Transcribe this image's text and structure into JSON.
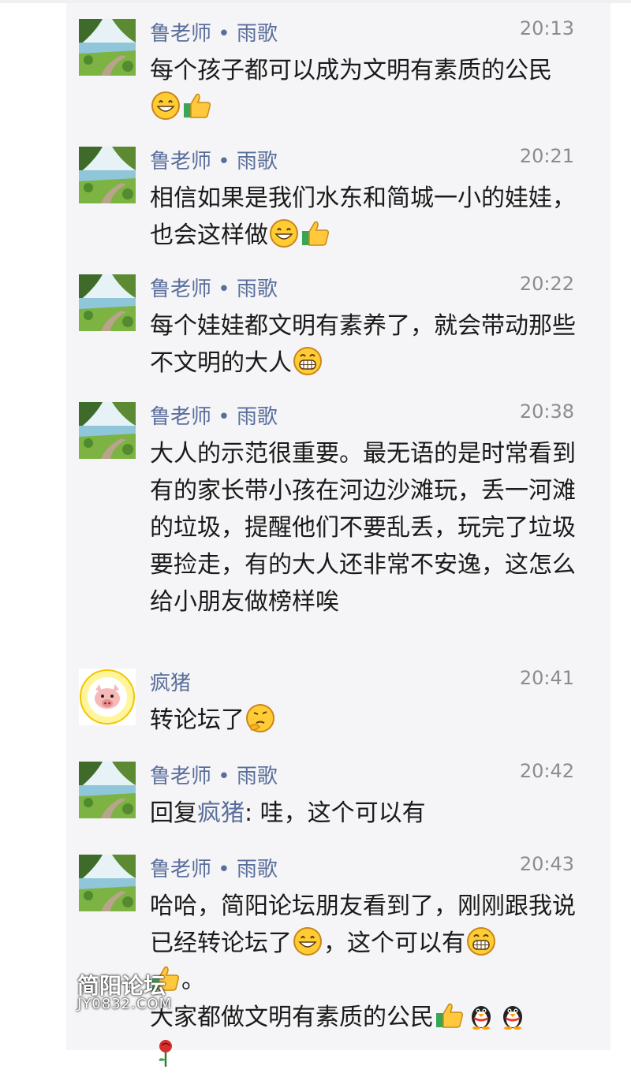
{
  "messages": [
    {
      "user": "鲁老师 • 雨歌",
      "time": "20:13",
      "avatar": "landscape-avatar",
      "text": "每个孩子都可以成为文明有素质的公民",
      "emojis": [
        "grin-emoji",
        "thumbs-up-emoji"
      ]
    },
    {
      "user": "鲁老师 • 雨歌",
      "time": "20:21",
      "avatar": "landscape-avatar",
      "text": "相信如果是我们水东和简城一小的娃娃，也会这样做",
      "emojis": [
        "grin-emoji",
        "thumbs-up-emoji"
      ]
    },
    {
      "user": "鲁老师 • 雨歌",
      "time": "20:22",
      "avatar": "landscape-avatar",
      "text": "每个娃娃都文明有素养了，就会带动那些不文明的大人",
      "emojis": [
        "big-grin-emoji"
      ]
    },
    {
      "user": "鲁老师 • 雨歌",
      "time": "20:38",
      "avatar": "landscape-avatar",
      "text": "大人的示范很重要。最无语的是时常看到有的家长带小孩在河边沙滩玩，丢一河滩的垃圾，提醒他们不要乱丢，玩完了垃圾要捡走，有的大人还非常不安逸，这怎么给小朋友做榜样唉",
      "emojis": []
    },
    {
      "user": "疯猪",
      "time": "20:41",
      "avatar": "pig-avatar",
      "text": "转论坛了",
      "emojis": [
        "thinking-emoji"
      ]
    },
    {
      "user": "鲁老师 • 雨歌",
      "time": "20:42",
      "avatar": "landscape-avatar",
      "reply_prefix": "回复",
      "reply_to": "疯猪",
      "reply_text": ": 哇，这个可以有",
      "emojis": []
    },
    {
      "user": "鲁老师 • 雨歌",
      "time": "20:43",
      "avatar": "landscape-avatar",
      "text_part1": "哈哈，简阳论坛朋友看到了，刚刚跟我说已经转论坛了",
      "text_part2": "，这个可以有",
      "text_part3": "。",
      "text_part4": "大家都做文明有素质的公民",
      "emojis": [
        "grin-emoji",
        "big-grin-emoji",
        "thumbs-up-emoji",
        "thumbs-up-emoji",
        "penguin-emoji",
        "penguin-emoji",
        "rose-emoji"
      ]
    }
  ],
  "watermark": {
    "line1": "简阳论坛",
    "line2": "JY0832.COM"
  }
}
